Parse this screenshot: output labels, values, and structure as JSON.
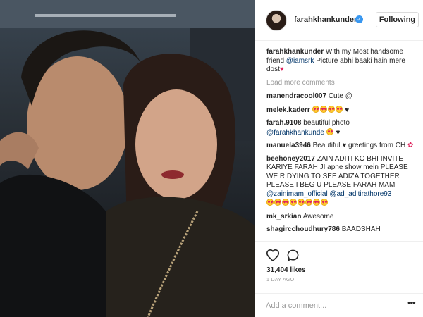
{
  "post": {
    "image": {
      "description": ""
    },
    "header": {
      "username": "farahkhankunder",
      "verified_icon": "verified-badge-icon",
      "follow_label": "Following"
    },
    "caption": {
      "username": "farahkhankunder",
      "text_before": "With my Most handsome friend",
      "mention": "@iamsrk",
      "text_after": "Picture abhi baaki hain mere dost"
    },
    "load_more": "Load more comments",
    "comments": [
      {
        "username": "manendracool007",
        "text": "Cute @"
      },
      {
        "username": "melek.kaderr",
        "text": ""
      },
      {
        "username": "farah.9108",
        "text": "beautiful photo",
        "mention": "@farahkhankunde"
      },
      {
        "username": "manuela3946",
        "text": "Beautiful.",
        "text_after": "greetings from CH"
      },
      {
        "username": "beehoney2017",
        "text": "ZAIN ADITI KO BHI INVITE KARIYE FARAH JI apne show mein PLEASE WE R DYING TO SEE ADIZA TOGETHER PLEASE I BEG U PLEASE FARAH MAM",
        "mention": "@zainimam_official @ad_aditirathore93"
      },
      {
        "username": "mk_srkian",
        "text": "Awesome"
      },
      {
        "username": "shagircchoudhury786",
        "text": "BAADSHAH"
      }
    ],
    "actions": {
      "like_icon": "heart-outline-icon",
      "comment_icon": "comment-bubble-icon",
      "likes": "31,404 likes",
      "time": "1 DAY AGO"
    },
    "add_comment": {
      "placeholder": "Add a comment...",
      "more_icon": "ellipsis-icon"
    }
  },
  "colors": {
    "link": "#003569",
    "verified": "#3897f0",
    "muted": "#999999",
    "border": "#efefef"
  }
}
